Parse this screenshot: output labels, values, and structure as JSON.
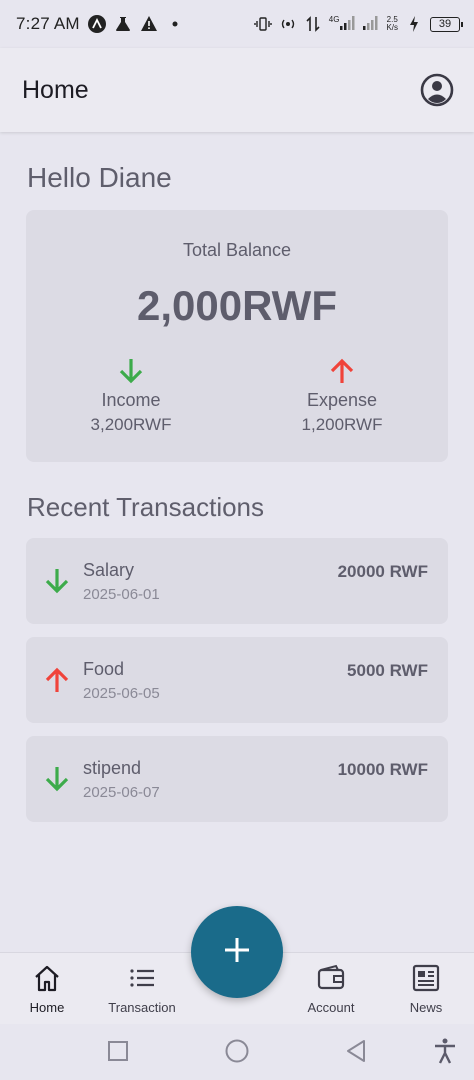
{
  "status_bar": {
    "time": "7:27 AM",
    "network_type": "4G",
    "speed_value": "2.5",
    "speed_unit": "K/s",
    "battery": "39",
    "icons": [
      "a-logo-icon",
      "flask-icon",
      "warning-icon",
      "dot-icon",
      "vibrate-icon",
      "hotspot-icon",
      "data-arrows-icon",
      "signal-icon",
      "signal-icon",
      "charging-icon",
      "battery-icon"
    ]
  },
  "app_bar": {
    "title": "Home",
    "profile_icon": "account-circle-icon"
  },
  "greeting": "Hello Diane",
  "balance": {
    "label": "Total Balance",
    "value": "2,000RWF",
    "income_label": "Income",
    "income_value": "3,200RWF",
    "expense_label": "Expense",
    "expense_value": "1,200RWF",
    "income_color": "#3dab4b",
    "expense_color": "#f0433a"
  },
  "recent_title": "Recent Transactions",
  "transactions": [
    {
      "title": "Salary",
      "date": "2025-06-01",
      "amount": "20000 RWF",
      "type": "income"
    },
    {
      "title": "Food",
      "date": "2025-06-05",
      "amount": "5000 RWF",
      "type": "expense"
    },
    {
      "title": "stipend",
      "date": "2025-06-07",
      "amount": "10000 RWF",
      "type": "income"
    }
  ],
  "bottom_nav": {
    "home": "Home",
    "transaction": "Transaction",
    "account": "Account",
    "news": "News",
    "fab_icon": "plus-icon",
    "fab_color": "#1a6b8a"
  },
  "system_nav": {
    "icons": [
      "square-recents-icon",
      "circle-home-icon",
      "triangle-back-icon",
      "accessibility-icon"
    ]
  }
}
